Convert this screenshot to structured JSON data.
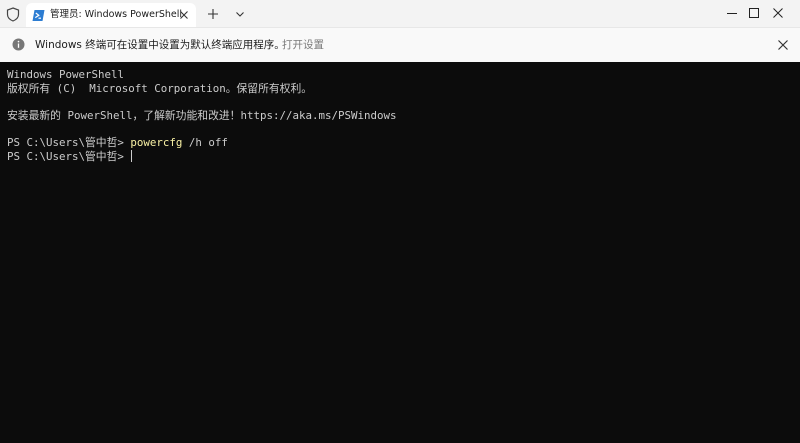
{
  "titlebar": {
    "tab_title": "管理员: Windows PowerShell",
    "new_tab_symbol": "+",
    "icons": [
      "shield-icon",
      "powershell-icon",
      "close-icon",
      "plus-icon",
      "chevron-down-icon",
      "minimize-icon",
      "maximize-icon",
      "close-icon"
    ]
  },
  "infobar": {
    "message": "Windows 终端可在设置中设置为默认终端应用程序。",
    "link": "打开设置",
    "icons": [
      "info-icon",
      "close-icon"
    ]
  },
  "terminal": {
    "lines": [
      "Windows PowerShell",
      "版权所有 (C)  Microsoft Corporation。保留所有权利。",
      "",
      "安装最新的 PowerShell，了解新功能和改进！https://aka.ms/PSWindows",
      ""
    ],
    "prompt1": "PS C:\\Users\\管中哲> ",
    "command1": "powercfg",
    "command1_args": " /h off",
    "prompt2": "PS C:\\Users\\管中哲> "
  },
  "colors": {
    "terminal_background": "#0c0c0c",
    "terminal_text": "#cccccc",
    "command_text": "#f9f1a5",
    "titlebar_background": "#f3f3f3",
    "accent": "#0078d4"
  }
}
